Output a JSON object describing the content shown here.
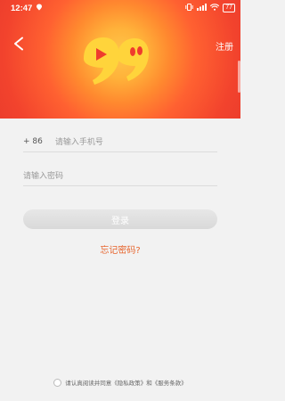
{
  "status_bar": {
    "time": "12:47",
    "battery": "77"
  },
  "header": {
    "register_label": "注册"
  },
  "form": {
    "phone": {
      "country_code": "+ 86",
      "placeholder": "请输入手机号"
    },
    "password": {
      "placeholder": "请输入密码"
    },
    "login_label": "登录",
    "forgot_label": "忘记密码?"
  },
  "agreement": {
    "text": "请认真阅读并同意《隐私政策》和《服务条款》"
  },
  "colors": {
    "header_red": "#e83a2c",
    "logo_yellow": "#ffd43b",
    "link_orange": "#e7652e"
  }
}
